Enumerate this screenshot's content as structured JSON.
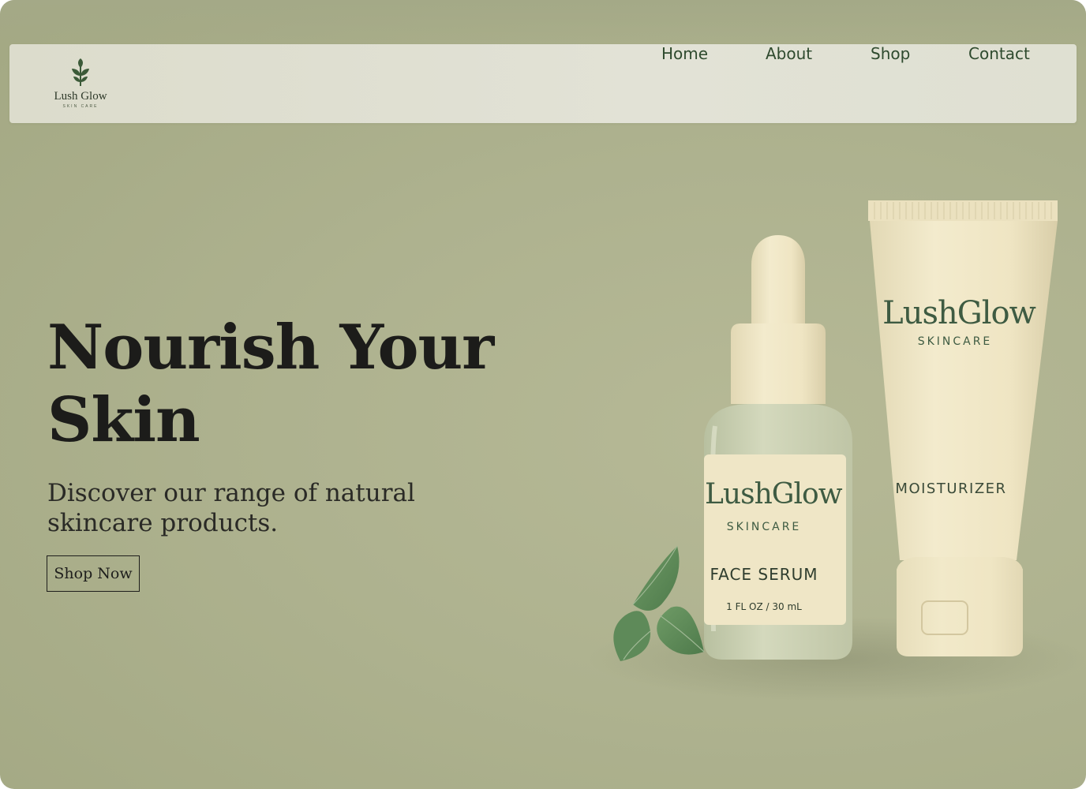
{
  "brand": {
    "name": "Lush Glow",
    "tagline": "SKIN CARE"
  },
  "nav": {
    "items": [
      {
        "label": "Home"
      },
      {
        "label": "About"
      },
      {
        "label": "Shop"
      },
      {
        "label": "Contact"
      }
    ]
  },
  "hero": {
    "title": "Nourish Your Skin",
    "subtitle": "Discover our range of natural skincare products.",
    "cta_label": "Shop Now"
  },
  "products": {
    "serum": {
      "brand": "LushGlow",
      "line": "SKINCARE",
      "name": "FACE SERUM",
      "volume": "1 FL OZ / 30 mL"
    },
    "moisturizer": {
      "brand": "LushGlow",
      "line": "SKINCARE",
      "name": "MOISTURIZER"
    }
  },
  "colors": {
    "background": "#aeb28f",
    "nav_background": "#e0e0d2",
    "nav_text": "#2e4a2e",
    "heading_text": "#1c1c1a",
    "product_cream": "#efe6c6",
    "product_label_green": "#3e5b42",
    "leaf_green": "#5f8a5a"
  },
  "icons": {
    "logo": "leaf-sprig-icon"
  }
}
